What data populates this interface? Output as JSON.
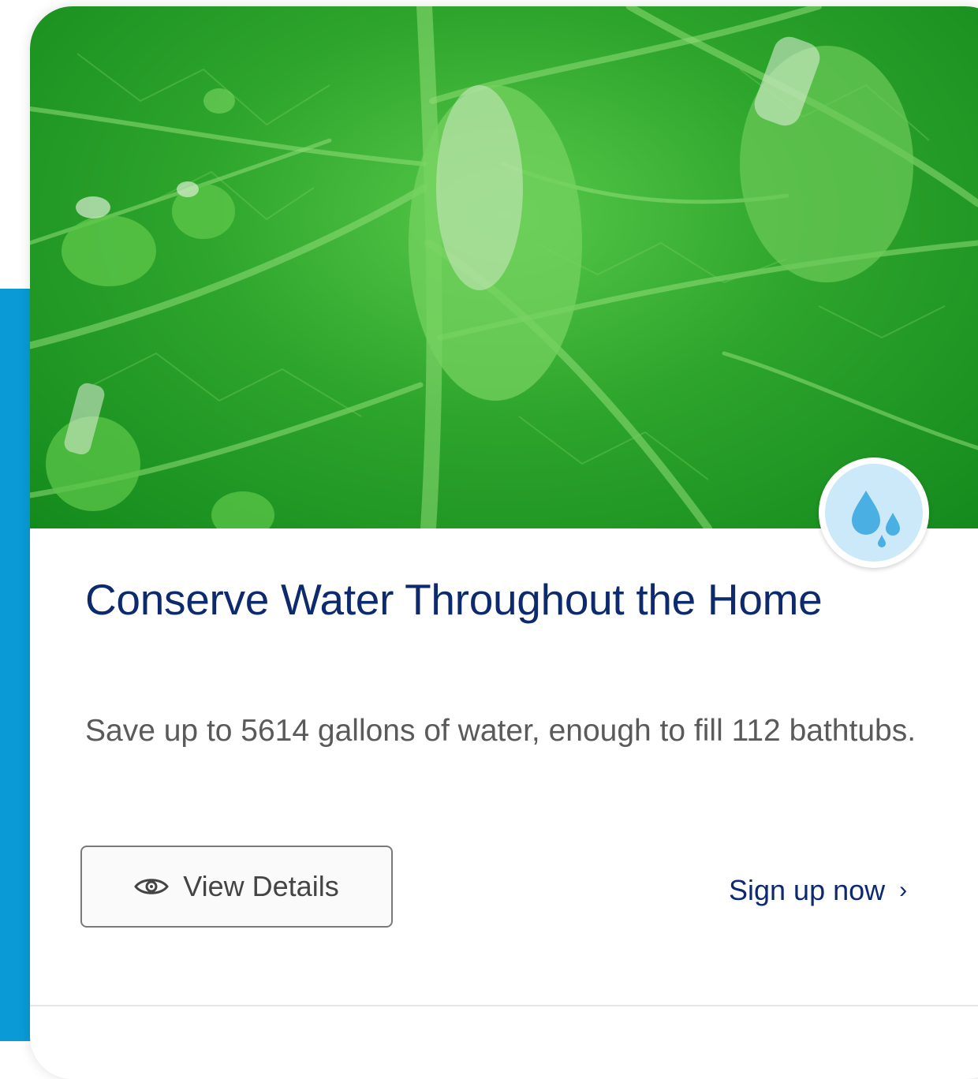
{
  "card": {
    "title": "Conserve Water Throughout the Home",
    "description": "Save up to 5614 gallons of water, enough to fill 112 bathtubs.",
    "view_details_label": "View Details",
    "sign_up_label": "Sign up now",
    "chevron": "›",
    "badge_icon": "water-drops-icon",
    "hero_image": "green-leaf-water-droplets"
  },
  "colors": {
    "accent_blue": "#0a9bd6",
    "title_navy": "#0d2a6e",
    "badge_bg": "#cbe9f8",
    "drop_blue": "#4aafe3"
  }
}
